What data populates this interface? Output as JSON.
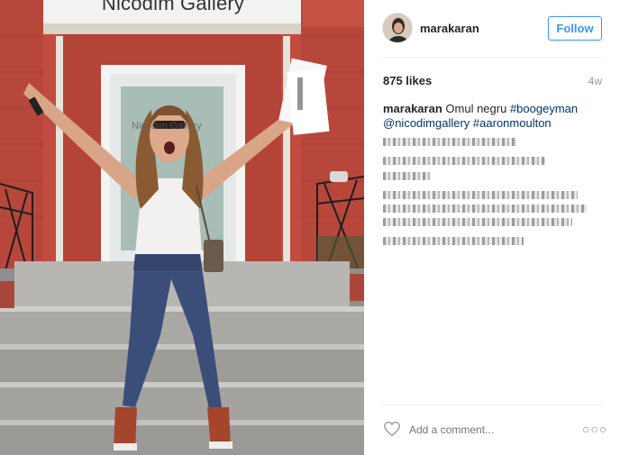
{
  "photo": {
    "sign_text": "Nicodim Gallery",
    "door_text": "Nicodim Gallery"
  },
  "header": {
    "username": "marakaran",
    "follow_label": "Follow"
  },
  "meta": {
    "likes": "875 likes",
    "age": "4w"
  },
  "caption": {
    "user": "marakaran",
    "text": "Omul negru",
    "tags": [
      "#boogeyman",
      "@nicodimgallery",
      "#aaronmoulton"
    ]
  },
  "comment": {
    "placeholder": "Add a comment..."
  },
  "icons": {
    "like": "heart-icon",
    "more": "more-options-icon"
  },
  "colors": {
    "accent": "#3897f0",
    "link": "#003569",
    "muted": "#999999"
  }
}
